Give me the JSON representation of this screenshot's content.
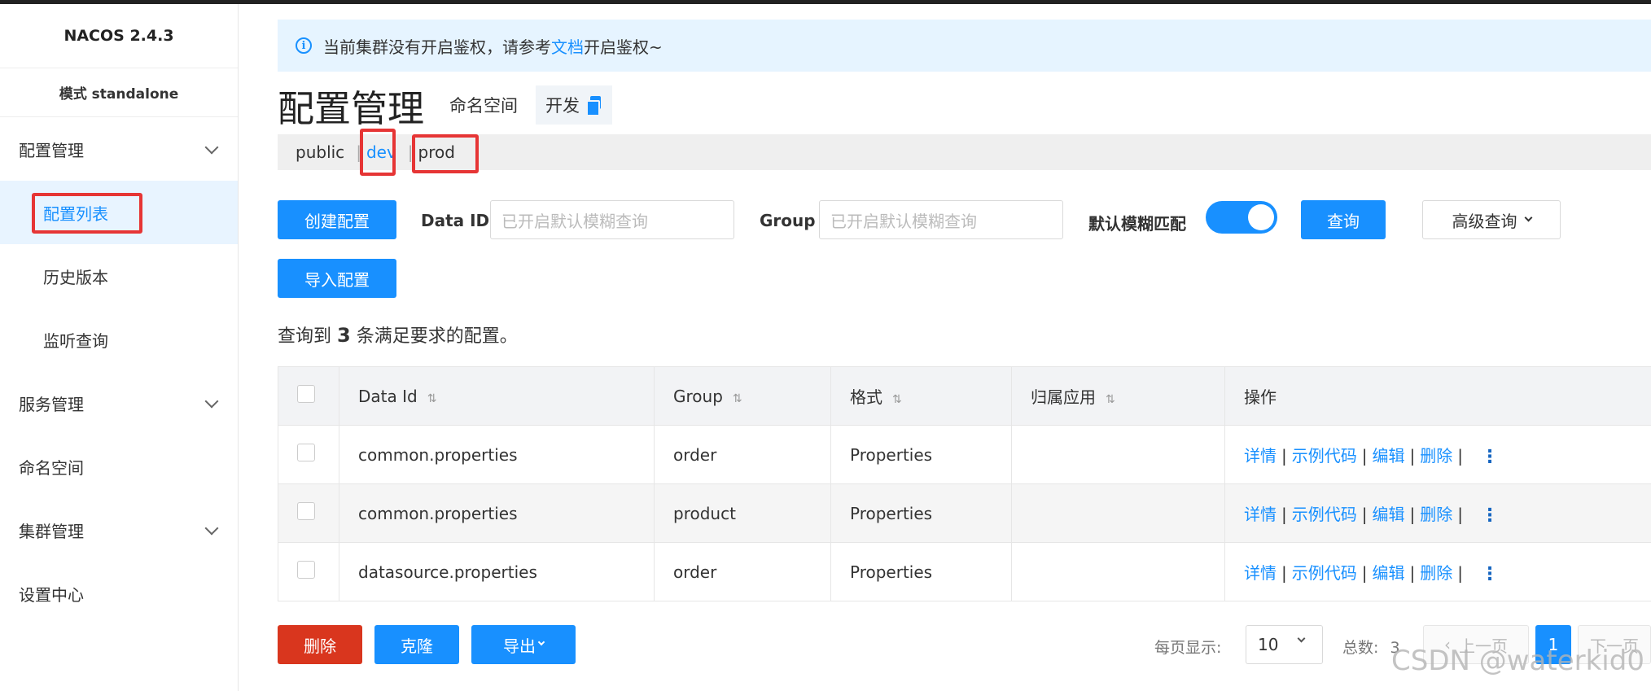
{
  "sidebar": {
    "brand": "NACOS 2.4.3",
    "mode": "模式 standalone",
    "config_mgmt": "配置管理",
    "config_list": "配置列表",
    "history": "历史版本",
    "listener": "监听查询",
    "service_mgmt": "服务管理",
    "namespace": "命名空间",
    "cluster_mgmt": "集群管理",
    "settings": "设置中心"
  },
  "notice": {
    "icon": "info-icon",
    "text_before": "当前集群没有开启鉴权，请参考",
    "link": "文档",
    "text_after": "开启鉴权~"
  },
  "header": {
    "title": "配置管理",
    "ns_label": "命名空间",
    "ns_current": "开发"
  },
  "ns_tabs": {
    "public": "public",
    "dev": "dev",
    "prod": "prod",
    "sep": "|"
  },
  "filter": {
    "create_button": "创建配置",
    "import_button": "导入配置",
    "dataid_label": "Data ID",
    "dataid_placeholder": "已开启默认模糊查询",
    "group_label": "Group",
    "group_placeholder": "已开启默认模糊查询",
    "fuzzy_label": "默认模糊匹配",
    "fuzzy_enabled": true,
    "query_button": "查询",
    "advanced_button": "高级查询"
  },
  "result": {
    "prefix": "查询到",
    "count": "3",
    "suffix": "条满足要求的配置。"
  },
  "table": {
    "columns": [
      "Data Id",
      "Group",
      "格式",
      "归属应用",
      "操作"
    ],
    "rows": [
      {
        "data_id": "common.properties",
        "group": "order",
        "format": "Properties",
        "app": ""
      },
      {
        "data_id": "common.properties",
        "group": "product",
        "format": "Properties",
        "app": ""
      },
      {
        "data_id": "datasource.properties",
        "group": "order",
        "format": "Properties",
        "app": ""
      }
    ],
    "ops": {
      "detail": "详情",
      "sample": "示例代码",
      "edit": "编辑",
      "delete": "删除",
      "sep": "|"
    }
  },
  "footer": {
    "delete_button": "删除",
    "clone_button": "克隆",
    "export_button": "导出",
    "page_size_label": "每页显示:",
    "page_size": "10",
    "total_label": "总数:",
    "total": "3",
    "prev": "上一页",
    "page": "1",
    "next": "下一页"
  },
  "watermark": "CSDN @waterkid0",
  "colors": {
    "primary": "#1890ff",
    "danger": "#d9361e",
    "highlight": "#e63535"
  }
}
